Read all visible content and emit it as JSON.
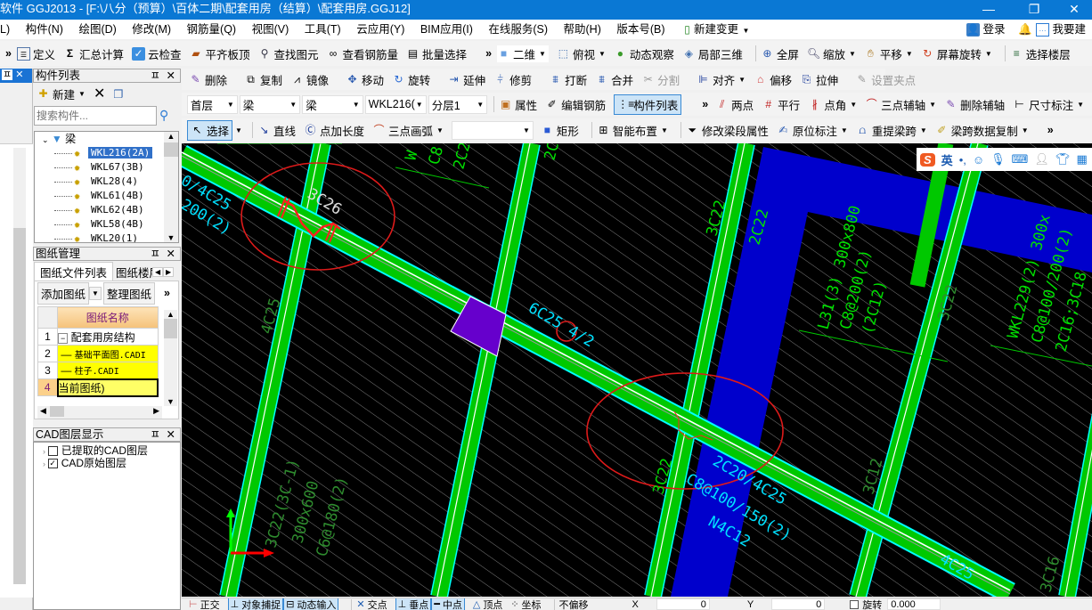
{
  "window": {
    "title": "软件 GGJ2013 - [F:\\八分（预算）\\百体二期\\配套用房（结算）\\配套用房.GGJ12]",
    "minimize": "—",
    "maximize": "❐",
    "close": "✕"
  },
  "menu": {
    "items": [
      "L)",
      "构件(N)",
      "绘图(D)",
      "修改(M)",
      "钢筋量(Q)",
      "视图(V)",
      "工具(T)",
      "云应用(Y)",
      "BIM应用(I)",
      "在线服务(S)",
      "帮助(H)",
      "版本号(B)",
      "新建变更"
    ],
    "login": "登录",
    "suggest": "我要建议"
  },
  "toolbar1": {
    "left": [
      "定义",
      "汇总计算",
      "云检查",
      "平齐板顶",
      "查找图元",
      "查看钢筋量",
      "批量选择"
    ],
    "view": [
      "二维",
      "俯视",
      "动态观察",
      "局部三维"
    ],
    "nav": [
      "全屏",
      "缩放",
      "平移",
      "屏幕旋转"
    ],
    "floor": "选择楼层"
  },
  "toolbar2": {
    "items": [
      "删除",
      "复制",
      "镜像",
      "移动",
      "旋转",
      "延伸",
      "修剪",
      "打断",
      "合并",
      "分割",
      "对齐",
      "偏移",
      "拉伸",
      "设置夹点"
    ]
  },
  "toolbar3": {
    "floor": "首层",
    "type": "梁",
    "subtype": "梁",
    "component": "WKL216(",
    "layer": "分层1",
    "props": "属性",
    "edit_rebar": "编辑钢筋",
    "component_list": "构件列表",
    "axis": [
      "两点",
      "平行",
      "点角",
      "三点辅轴",
      "删除辅轴",
      "尺寸标注"
    ]
  },
  "toolbar4": {
    "items": [
      "选择",
      "直线",
      "点加长度",
      "三点画弧",
      "矩形",
      "智能布置",
      "修改梁段属性",
      "原位标注",
      "重提梁跨",
      "梁跨数据复制"
    ]
  },
  "component_panel": {
    "title": "构件列表",
    "new": "新建",
    "search_placeholder": "搜索构件...",
    "root": "梁",
    "items": [
      "WKL216(2A)",
      "WKL67(3B)",
      "WKL28(4)",
      "WKL61(4B)",
      "WKL62(4B)",
      "WKL58(4B)",
      "WKL20(1)"
    ],
    "selected": 0
  },
  "drawing_panel": {
    "title": "图纸管理",
    "tabs": [
      "图纸文件列表",
      "图纸楼层"
    ],
    "add": "添加图纸",
    "organize": "整理图纸",
    "column": "图纸名称",
    "rows": [
      {
        "n": "1",
        "name": "配套用房结构"
      },
      {
        "n": "2",
        "name": "基础平面图.CADI"
      },
      {
        "n": "3",
        "name": "柱子.CADI"
      },
      {
        "n": "4",
        "name": "当前图纸)"
      }
    ]
  },
  "layer_panel": {
    "title": "CAD图层显示",
    "items": [
      {
        "label": "已提取的CAD图层",
        "checked": false
      },
      {
        "label": "CAD原始图层",
        "checked": true
      }
    ]
  },
  "ime": {
    "logo": "S",
    "lang": "英",
    "punct": "•,"
  },
  "canvas": {
    "labels": [
      "0/4C25",
      "200(2)",
      "3C26",
      "6C25 4/2",
      "4C25",
      "3C22(3C-1)",
      "300x600",
      "C6@180(2)",
      "W",
      "C8",
      "2C2",
      "2C22",
      "3C22",
      "2C22",
      "L31(3) 300x800",
      "C8@200(2)",
      "(2C12)",
      "3C22",
      "WKL229(2) 300x",
      "C8@100/200(2)",
      "2C16;3C18",
      "3C22",
      "3C12",
      "2C20/4C25",
      "C8@100/150(2)",
      "N4C12",
      "4C25",
      "3C16"
    ]
  },
  "statusbar": {
    "items": [
      "正交",
      "对象捕捉",
      "动态输入",
      "交点",
      "垂点",
      "中点",
      "顶点",
      "坐标",
      "不偏移"
    ],
    "x_label": "X",
    "x_value": "0",
    "y_label": "Y",
    "y_value": "0",
    "rotate_label": "旋转",
    "rotate_value": "0.000"
  },
  "colors": {
    "titlebar": "#0a78d4",
    "beam_green": "#00c800",
    "beam_edge": "#00ffff",
    "slab_blue": "#0000cc",
    "column_purple": "#6600cc",
    "mark_red": "#e00000"
  }
}
